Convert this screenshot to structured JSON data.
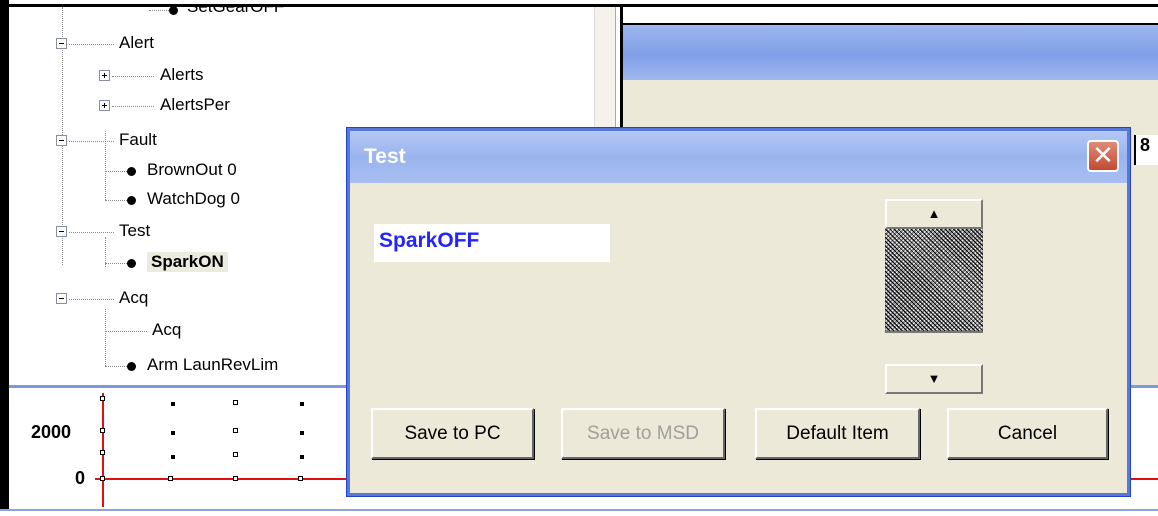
{
  "tree": {
    "items": [
      {
        "label": "SetGearOFF",
        "type": "leaf",
        "depth": 2
      },
      {
        "label": "Alert",
        "type": "folder-open",
        "depth": 1
      },
      {
        "label": "Alerts",
        "type": "folder-closed",
        "depth": 2
      },
      {
        "label": "AlertsPer",
        "type": "folder-closed",
        "depth": 2
      },
      {
        "label": "Fault",
        "type": "folder-open",
        "depth": 1
      },
      {
        "label": "BrownOut  0",
        "type": "leaf",
        "depth": 2
      },
      {
        "label": "WatchDog  0",
        "type": "leaf",
        "depth": 2
      },
      {
        "label": "Test",
        "type": "folder-open",
        "depth": 1
      },
      {
        "label": "SparkON",
        "type": "leaf-selected",
        "depth": 2
      },
      {
        "label": "Acq",
        "type": "folder-open",
        "depth": 1
      },
      {
        "label": "Acq",
        "type": "plain",
        "depth": 2
      },
      {
        "label": "Arm LaunRevLim",
        "type": "leaf",
        "depth": 2
      }
    ]
  },
  "right_panel": {
    "edge_text": "8"
  },
  "graph": {
    "y_labels": [
      "2000",
      "0"
    ],
    "line_color": "#e01010"
  },
  "dialog": {
    "title": "Test",
    "close_symbol": "✕",
    "value": "SparkOFF",
    "spin_up_symbol": "▲",
    "spin_down_symbol": "▼",
    "buttons": {
      "save_pc": "Save to PC",
      "save_msd": "Save to MSD",
      "default_item": "Default Item",
      "cancel": "Cancel"
    },
    "colors": {
      "title_bar": "#9ab4ee",
      "value_text": "#2323ff",
      "close_button": "#c24a31"
    }
  }
}
